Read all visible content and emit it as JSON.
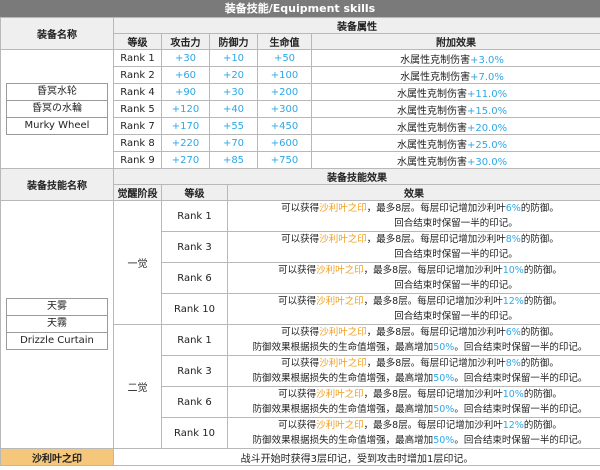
{
  "title": "装备技能/Equipment skills",
  "attr_section": {
    "name_header": "装备名称",
    "attr_header": "装备属性",
    "columns": [
      "等级",
      "攻击力",
      "防御力",
      "生命值",
      "附加效果"
    ],
    "names": [
      "昏冥水轮",
      "昏冥の水輪",
      "Murky Wheel"
    ],
    "rows": [
      {
        "rank": "Rank 1",
        "atk": "+30",
        "def": "+10",
        "hp": "+50",
        "effect_text": "水属性克制伤害",
        "effect_value": "+3.0%"
      },
      {
        "rank": "Rank 2",
        "atk": "+60",
        "def": "+20",
        "hp": "+100",
        "effect_text": "水属性克制伤害",
        "effect_value": "+7.0%"
      },
      {
        "rank": "Rank 4",
        "atk": "+90",
        "def": "+30",
        "hp": "+200",
        "effect_text": "水属性克制伤害",
        "effect_value": "+11.0%"
      },
      {
        "rank": "Rank 5",
        "atk": "+120",
        "def": "+40",
        "hp": "+300",
        "effect_text": "水属性克制伤害",
        "effect_value": "+15.0%"
      },
      {
        "rank": "Rank 7",
        "atk": "+170",
        "def": "+55",
        "hp": "+450",
        "effect_text": "水属性克制伤害",
        "effect_value": "+20.0%"
      },
      {
        "rank": "Rank 8",
        "atk": "+220",
        "def": "+70",
        "hp": "+600",
        "effect_text": "水属性克制伤害",
        "effect_value": "+25.0%"
      },
      {
        "rank": "Rank 9",
        "atk": "+270",
        "def": "+85",
        "hp": "+750",
        "effect_text": "水属性克制伤害",
        "effect_value": "+30.0%"
      }
    ]
  },
  "skill_section": {
    "name_header": "装备技能名称",
    "effect_header": "装备技能效果",
    "columns": [
      "觉醒阶段",
      "等级",
      "效果"
    ],
    "names": [
      "天雾",
      "天霧",
      "Drizzle Curtain"
    ],
    "stage1": {
      "label": "一觉",
      "rows": [
        {
          "rank": "Rank 1",
          "l1a": "可以获得",
          "l1b": "沙利叶之印",
          "l1c": "，最多8层。每层印记增加沙利叶",
          "l1d": "6%",
          "l1e": "的防御。",
          "l2": "回合结束时保留一半的印记。"
        },
        {
          "rank": "Rank 3",
          "l1a": "可以获得",
          "l1b": "沙利叶之印",
          "l1c": "，最多8层。每层印记增加沙利叶",
          "l1d": "8%",
          "l1e": "的防御。",
          "l2": "回合结束时保留一半的印记。"
        },
        {
          "rank": "Rank 6",
          "l1a": "可以获得",
          "l1b": "沙利叶之印",
          "l1c": "，最多8层。每层印记增加沙利叶",
          "l1d": "10%",
          "l1e": "的防御。",
          "l2": "回合结束时保留一半的印记。"
        },
        {
          "rank": "Rank 10",
          "l1a": "可以获得",
          "l1b": "沙利叶之印",
          "l1c": "，最多8层。每层印记增加沙利叶",
          "l1d": "12%",
          "l1e": "的防御。",
          "l2": "回合结束时保留一半的印记。"
        }
      ]
    },
    "stage2": {
      "label": "二觉",
      "rows": [
        {
          "rank": "Rank 1",
          "l1a": "可以获得",
          "l1b": "沙利叶之印",
          "l1c": "，最多8层。每层印记增加沙利叶",
          "l1d": "6%",
          "l1e": "的防御。",
          "l2a": "防御效果根据损失的生命值增强，最高增加",
          "l2b": "50%",
          "l2c": "。回合结束时保留一半的印记。"
        },
        {
          "rank": "Rank 3",
          "l1a": "可以获得",
          "l1b": "沙利叶之印",
          "l1c": "，最多8层。每层印记增加沙利叶",
          "l1d": "8%",
          "l1e": "的防御。",
          "l2a": "防御效果根据损失的生命值增强，最高增加",
          "l2b": "50%",
          "l2c": "。回合结束时保留一半的印记。"
        },
        {
          "rank": "Rank 6",
          "l1a": "可以获得",
          "l1b": "沙利叶之印",
          "l1c": "，最多8层。每层印记增加沙利叶",
          "l1d": "10%",
          "l1e": "的防御。",
          "l2a": "防御效果根据损失的生命值增强，最高增加",
          "l2b": "50%",
          "l2c": "。回合结束时保留一半的印记。"
        },
        {
          "rank": "Rank 10",
          "l1a": "可以获得",
          "l1b": "沙利叶之印",
          "l1c": "，最多8层。每层印记增加沙利叶",
          "l1d": "12%",
          "l1e": "的防御。",
          "l2a": "防御效果根据损失的生命值增强，最高增加",
          "l2b": "50%",
          "l2c": "。回合结束时保留一半的印记。"
        }
      ]
    }
  },
  "footer": {
    "label": "沙利叶之印",
    "text": "战斗开始时获得3层印记，受到攻击时增加1层印记。"
  },
  "colors": {
    "highlight_blue": "#2fa7e6",
    "highlight_orange": "#f0a020",
    "title_bg": "#7a7a7a",
    "footer_bg": "#f5c77a"
  }
}
